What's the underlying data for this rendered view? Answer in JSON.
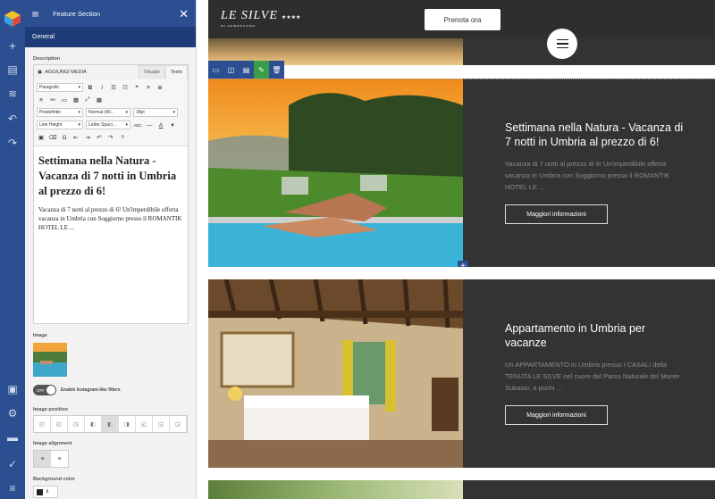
{
  "panel": {
    "title": "Feature Section",
    "close": "✕",
    "tab": "General",
    "description_label": "Description",
    "add_media": "AGGIUNGI MEDIA",
    "tab_visual": "Visuale",
    "tab_text": "Testo",
    "format_select": "Paragrafo",
    "font_select": "Predefinito",
    "weight_select": "Normal (40...",
    "size_select": "18pt",
    "lineheight_select": "Line Height",
    "letterspacing_select": "Letter Spaci...",
    "editor_title": "Settimana nella Natura - Vacanza di 7 notti in Umbria al prezzo di 6!",
    "editor_body": "Vacanza di 7 notti al prezzo di 6! Un'imperdibile offerta vacanza in Umbria con Soggiorno presso il ROMANTIK HOTEL LE ...",
    "image_label": "Image",
    "off_toggle": "OFF",
    "instagram_filters_label": "Enable Instagram-like filters",
    "image_position_label": "Image position",
    "image_alignment_label": "Image alignment",
    "bg_color_label": "Background color",
    "bg_color": "#222222"
  },
  "site": {
    "brand_name": "LE SILVE",
    "brand_stars": "★★★★",
    "brand_sub": "DI ARMENZANO",
    "cta": "Prenota ora",
    "sections": [
      {
        "title": "Settimana nella Natura - Vacanza di 7 notti in Umbria al prezzo di 6!",
        "desc": "Vacanza di 7 notti al prezzo di 6! Un'imperdibile offerta vacanza in Umbria con Soggiorno presso il ROMANTIK HOTEL LE ...",
        "button": "Maggiori informazioni"
      },
      {
        "title": "Appartamento in Umbria per vacanze",
        "desc": "Un APPARTAMENTO in Umbria presso i CASALI della TENUTA LE SILVE nel cuore del Parco Naturale del Monte Subasio, a pochi ...",
        "button": "Maggiori informazioni"
      }
    ]
  },
  "colors": {
    "editor_blue": "#2b4f91",
    "editor_green": "#3a9d48",
    "site_dark": "#333333"
  }
}
